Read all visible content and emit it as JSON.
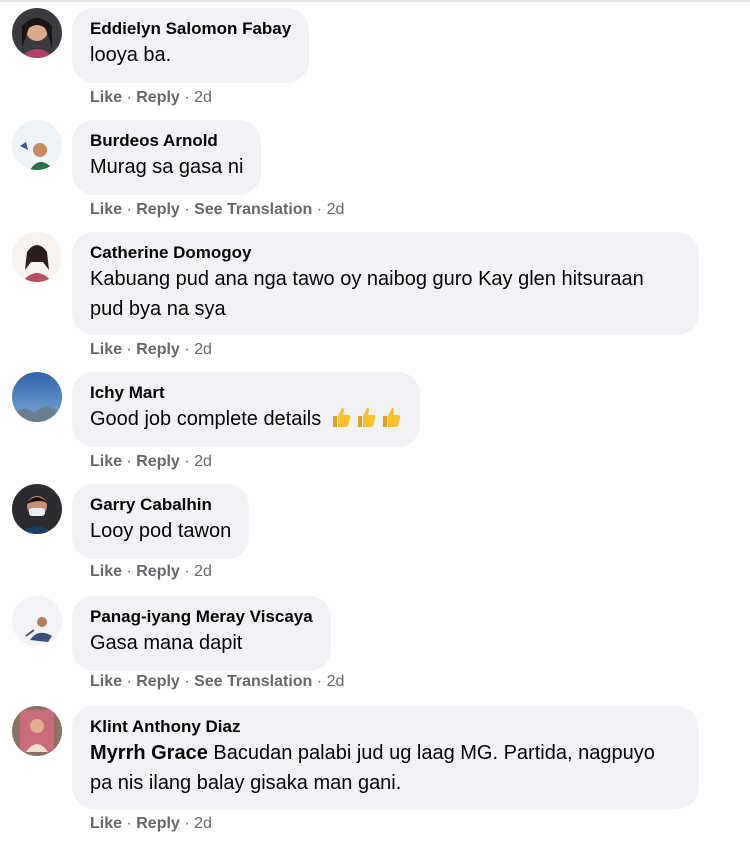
{
  "comments": [
    {
      "author": "Eddielyn Salomon Fabay",
      "text": "looya ba.",
      "like": "Like",
      "reply": "Reply",
      "time": "2d"
    },
    {
      "author": "Burdeos Arnold",
      "text": "Murag sa gasa ni",
      "like": "Like",
      "reply": "Reply",
      "translate": "See Translation",
      "time": "2d"
    },
    {
      "author": "Catherine Domogoy",
      "text": "Kabuang pud ana nga tawo oy naibog guro Kay glen hitsuraan pud bya na sya",
      "like": "Like",
      "reply": "Reply",
      "time": "2d"
    },
    {
      "author": "Ichy Mart",
      "text": "Good job complete details",
      "emoji": "thumbs-up-emoji x3",
      "like": "Like",
      "reply": "Reply",
      "time": "2d"
    },
    {
      "author": "Garry Cabalhin",
      "text": "Looy pod tawon",
      "like": "Like",
      "reply": "Reply",
      "time": "2d"
    },
    {
      "author": "Panag-iyang Meray Viscaya",
      "text": "Gasa mana dapit",
      "like": "Like",
      "reply": "Reply",
      "translate": "See Translation",
      "time": "2d"
    },
    {
      "author": "Klint Anthony Diaz",
      "mention": "Myrrh Grace",
      "text": " Bacudan palabi jud ug laag MG. Partida, nagpuyo pa nis ilang balay gisaka man gani.",
      "like": "Like",
      "reply": "Reply",
      "time": "2d"
    }
  ],
  "separator": "·",
  "colors": {
    "bubble": "#f0f2f5",
    "meta": "#65676b",
    "text": "#050505"
  }
}
